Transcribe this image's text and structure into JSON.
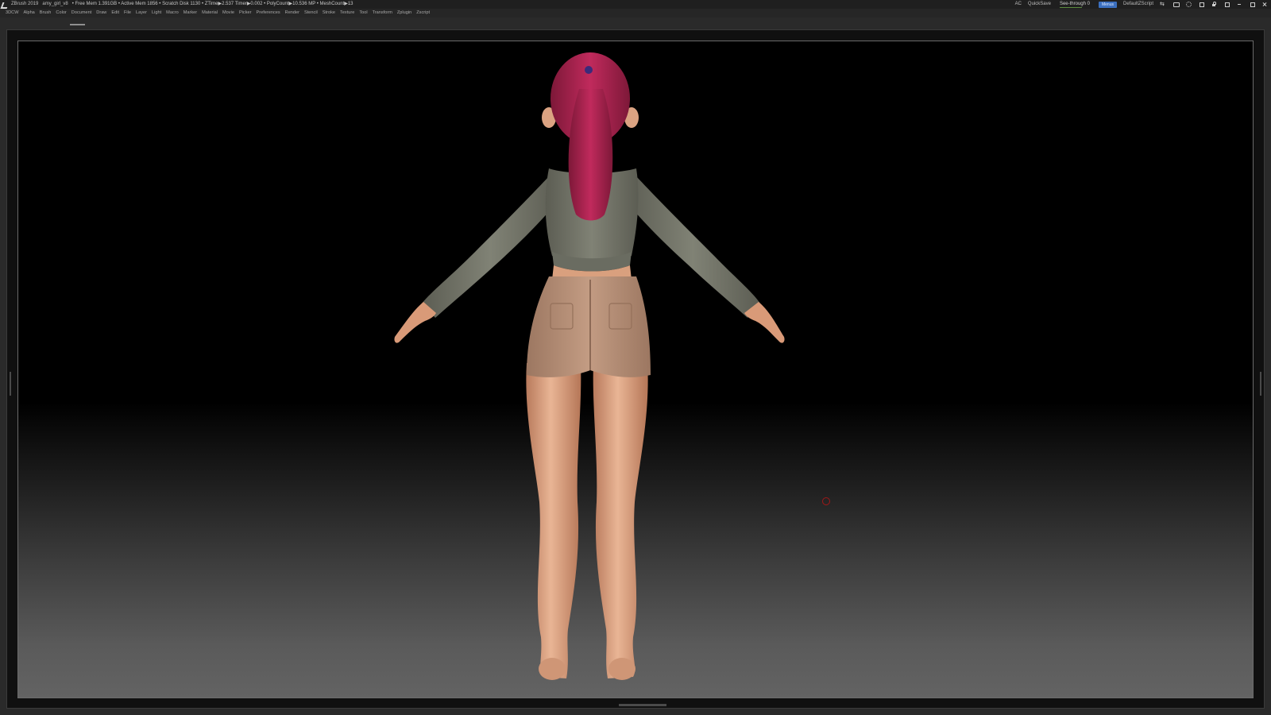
{
  "titlebar": {
    "app": "ZBrush 2019",
    "file": "amy_girl_v8",
    "stats": "• Free Mem 1.391GB • Active Mem 1856 • Scratch Disk 1130 • ZTime▶2.537 Timer▶0.002 • PolyCount▶10.536 MP • MeshCount▶13",
    "ac": "AC",
    "quicksave": "QuickSave",
    "see_through": "See-through  0",
    "menus": "Menus",
    "script": "DefaultZScript"
  },
  "menus": [
    "3DCW",
    "Alpha",
    "Brush",
    "Color",
    "Document",
    "Draw",
    "Edit",
    "File",
    "Layer",
    "Light",
    "Macro",
    "Marker",
    "Material",
    "Movie",
    "Picker",
    "Preferences",
    "Render",
    "Stencil",
    "Stroke",
    "Texture",
    "Tool",
    "Transform",
    "Zplugin",
    "Zscript"
  ],
  "icons": {
    "app": "zbrush-logo-icon",
    "cursor": "brush-cursor-icon"
  },
  "colors": {
    "menus_active": "#3b6fbf",
    "hair": "#a0204c",
    "shirt": "#76786c",
    "shorts": "#b08a72",
    "skin": "#e0a986",
    "cursor": "#a01818"
  }
}
